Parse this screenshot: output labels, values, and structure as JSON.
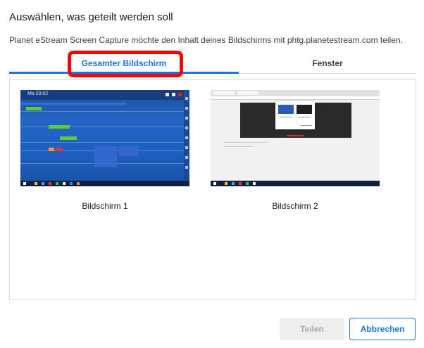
{
  "dialog": {
    "title": "Auswählen, was geteilt werden soll",
    "subtitle": "Planet eStream Screen Capture möchte den Inhalt deines Bildschirms mit phtg.planetestream.com teilen."
  },
  "tabs": [
    {
      "label": "Gesamter Bildschirm",
      "selected": true
    },
    {
      "label": "Fenster",
      "selected": false
    }
  ],
  "screens": [
    {
      "label": "Bildschirm 1",
      "thumb_clock": "Mo 20:02"
    },
    {
      "label": "Bildschirm 2"
    }
  ],
  "buttons": {
    "share_label": "Teilen",
    "cancel_label": "Abbrechen"
  },
  "colors": {
    "accent": "#1a73e8",
    "highlight": "#ff0000"
  }
}
